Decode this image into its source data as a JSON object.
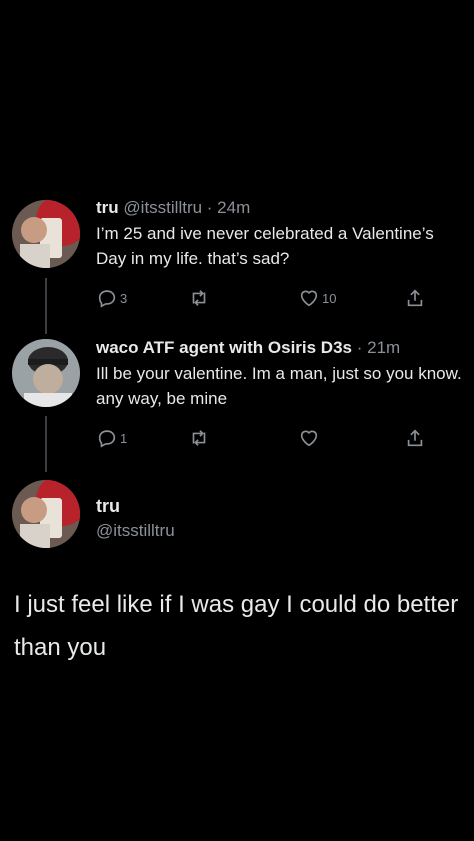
{
  "tweets": [
    {
      "name": "tru",
      "handle": "@itsstilltru",
      "time": "· 24m",
      "text": "I’m 25 and ive never celebrated a Valentine’s Day in my life. that’s sad?",
      "replies": "3",
      "retweets": "",
      "likes": "10"
    },
    {
      "name": "waco ATF agent with Osiris D3s",
      "handle": "",
      "time": "· 21m",
      "text": "Ill be your valentine. Im a man, just so you know. any way, be mine",
      "replies": "1",
      "retweets": "",
      "likes": ""
    }
  ],
  "main": {
    "name": "tru",
    "handle": "@itsstilltru",
    "text": "I just feel like if I was gay I could do better than you"
  },
  "icons": {
    "reply": "reply-icon",
    "retweet": "retweet-icon",
    "like": "heart-icon",
    "share": "share-icon"
  },
  "colors": {
    "background": "#000000",
    "text": "#e7e9ea",
    "secondary": "#8b9197",
    "thread_line": "#3b3f44"
  }
}
